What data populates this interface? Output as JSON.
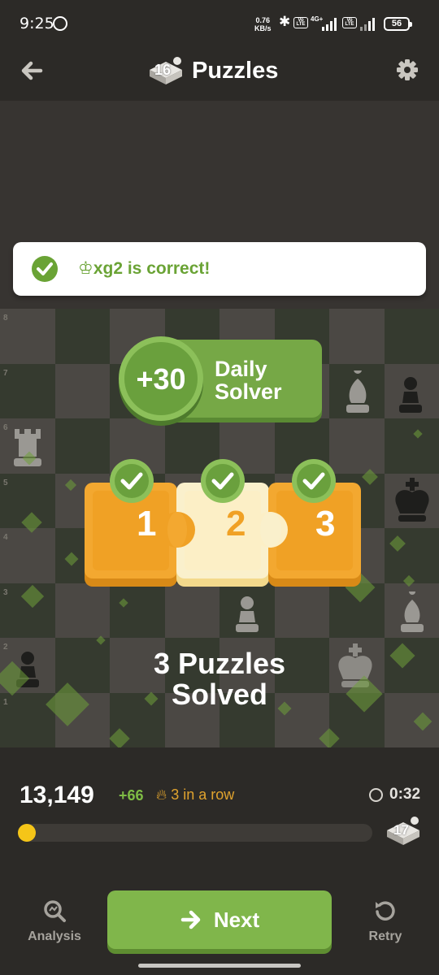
{
  "status_bar": {
    "time": "9:25",
    "speed_value": "0.76",
    "speed_unit": "KB/s",
    "volte_1": "Vo LTE",
    "network": "4G+",
    "volte_2": "Vo LTE",
    "battery": "56"
  },
  "header": {
    "title": "Puzzles",
    "puzzle_number": "16"
  },
  "toast": {
    "message": "♔xg2 is correct!"
  },
  "daily_solver": {
    "points": "+30",
    "line1": "Daily",
    "line2": "Solver"
  },
  "puzzle_pieces": [
    {
      "number": "1"
    },
    {
      "number": "2"
    },
    {
      "number": "3"
    }
  ],
  "solved": {
    "line1": "3 Puzzles",
    "line2": "Solved"
  },
  "board_labels": [
    "8",
    "7",
    "6",
    "5",
    "4",
    "3",
    "2",
    "1"
  ],
  "stats": {
    "rating": "13,149",
    "delta": "+66",
    "streak": "3 in a row",
    "timer": "0:32"
  },
  "progress": {
    "fraction": 0.05,
    "next_number": "17"
  },
  "buttons": {
    "analysis": "Analysis",
    "next": "Next",
    "retry": "Retry"
  },
  "colors": {
    "accent_green": "#80b64b",
    "correct_text": "#6aa335",
    "streak_orange": "#e0a32e",
    "progress_yellow": "#f5c518",
    "background": "#2c2a27"
  }
}
